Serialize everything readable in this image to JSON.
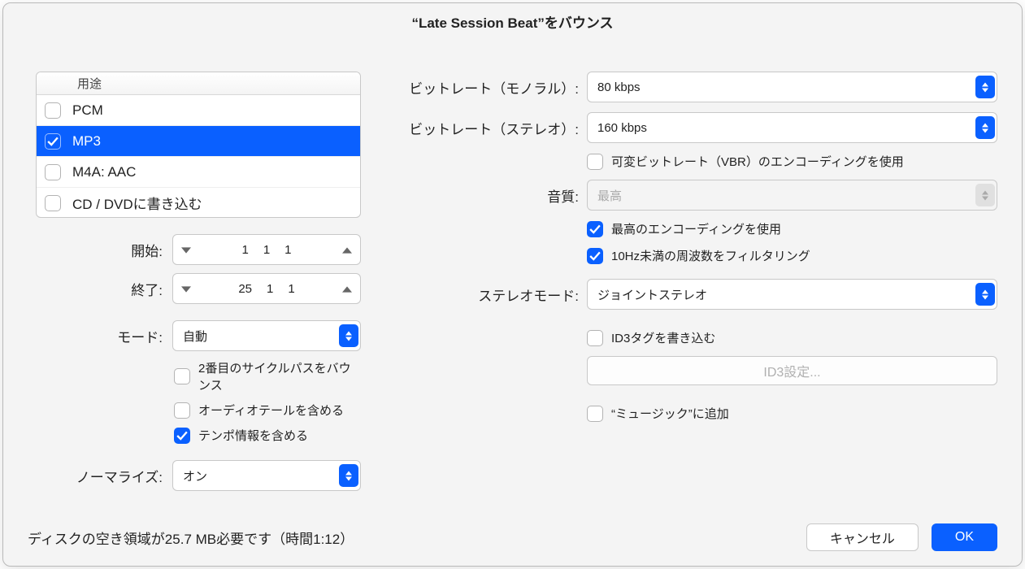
{
  "title": "“Late Session Beat”をバウンス",
  "formats": {
    "header": "用途",
    "items": [
      "PCM",
      "MP3",
      "M4A: AAC",
      "CD / DVDに書き込む"
    ],
    "checked_index": 1,
    "selected_index": 1
  },
  "left": {
    "start_label": "開始:",
    "start_values": [
      "1",
      "1",
      "1"
    ],
    "end_label": "終了:",
    "end_values": [
      "25",
      "1",
      "1"
    ],
    "mode_label": "モード:",
    "mode_value": "自動",
    "second_cycle_label": "2番目のサイクルパスをバウンス",
    "audio_tail_label": "オーディオテールを含める",
    "tempo_label": "テンポ情報を含める",
    "normalize_label": "ノーマライズ:",
    "normalize_value": "オン"
  },
  "right": {
    "br_mono_label": "ビットレート（モノラル）:",
    "br_mono_value": "80 kbps",
    "br_stereo_label": "ビットレート（ステレオ）:",
    "br_stereo_value": "160 kbps",
    "vbr_label": "可変ビットレート（VBR）のエンコーディングを使用",
    "quality_label": "音質:",
    "quality_value": "最高",
    "best_encoding_label": "最高のエンコーディングを使用",
    "filter_10hz_label": "10Hz未満の周波数をフィルタリング",
    "stereo_mode_label": "ステレオモード:",
    "stereo_mode_value": "ジョイントステレオ",
    "id3_write_label": "ID3タグを書き込む",
    "id3_settings_label": "ID3設定...",
    "add_music_label": "“ミュージック”に追加"
  },
  "footer": {
    "disk_info": "ディスクの空き領域が25.7 MB必要です（時間1:12）",
    "cancel": "キャンセル",
    "ok": "OK"
  }
}
